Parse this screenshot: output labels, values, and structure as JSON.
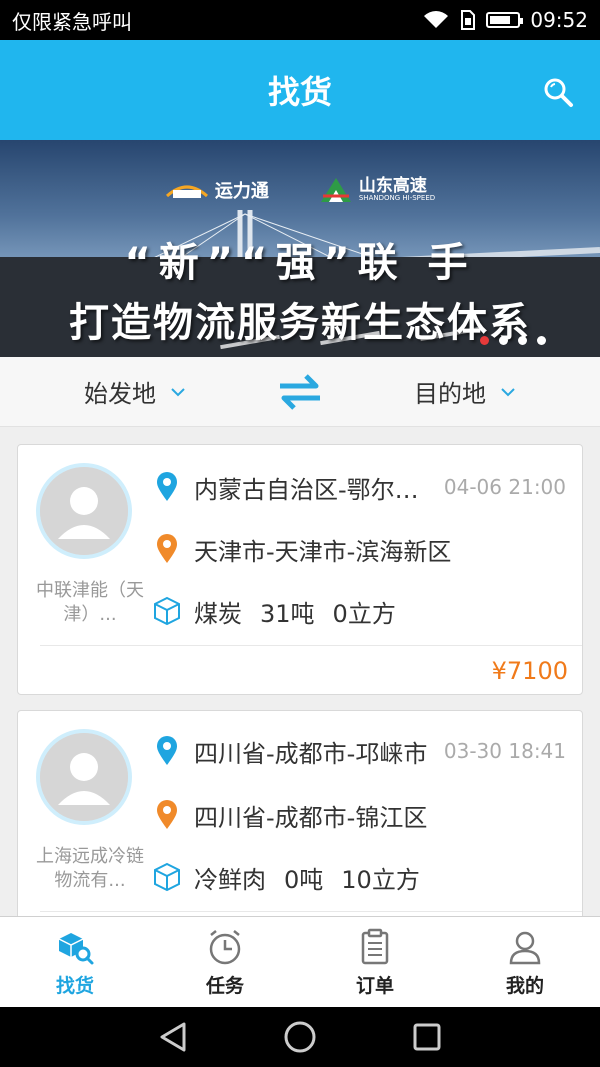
{
  "status_bar": {
    "carrier": "仅限紧急呼叫",
    "time": "09:52",
    "battery_level": 0.75
  },
  "header": {
    "title": "找货",
    "search_icon": "search-icon"
  },
  "banner": {
    "logo_left": "运力通",
    "logo_right": "山东高速",
    "logo_right_sub": "SHANDONG HI-SPEED",
    "slogan_line1": "“新”“强”联 手",
    "slogan_line2": "打造物流服务新生态体系",
    "slide_count": 4,
    "active_slide": 1
  },
  "filter": {
    "origin_label": "始发地",
    "destination_label": "目的地",
    "swap_icon": "swap-icon"
  },
  "listings": [
    {
      "company": "中联津能（天津）...",
      "origin": "内蒙古自治区-鄂尔多斯市-东胜区",
      "time": "04-06 21:00",
      "destination": "天津市-天津市-滨海新区",
      "goods_name": "煤炭",
      "weight": "31吨",
      "volume": "0立方",
      "price": "¥7100"
    },
    {
      "company": "上海远成冷链物流有...",
      "origin": "四川省-成都市-邛崃市",
      "time": "03-30 18:41",
      "destination": "四川省-成都市-锦江区",
      "goods_name": "冷鲜肉",
      "weight": "0吨",
      "volume": "10立方",
      "price": ""
    }
  ],
  "bottom_nav": [
    {
      "label": "找货",
      "icon": "box-search-icon",
      "active": true
    },
    {
      "label": "任务",
      "icon": "clock-icon",
      "active": false
    },
    {
      "label": "订单",
      "icon": "clipboard-icon",
      "active": false
    },
    {
      "label": "我的",
      "icon": "user-icon",
      "active": false
    }
  ],
  "colors": {
    "primary": "#20b6ee",
    "price": "#f07a1a",
    "origin_pin": "#1fa5e0",
    "destination_pin": "#f08a2a"
  }
}
